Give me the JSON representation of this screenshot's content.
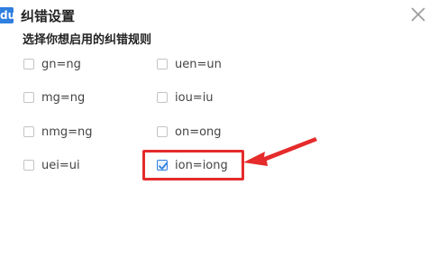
{
  "dialog": {
    "app_icon_text": "du",
    "title": "纠错设置",
    "close_glyph": "✕",
    "subtitle": "选择你想启用的纠错规则"
  },
  "options": [
    {
      "label": "gn=ng",
      "checked": false
    },
    {
      "label": "uen=un",
      "checked": false
    },
    {
      "label": "mg=ng",
      "checked": false
    },
    {
      "label": "iou=iu",
      "checked": false
    },
    {
      "label": "nmg=ng",
      "checked": false
    },
    {
      "label": "on=ong",
      "checked": false
    },
    {
      "label": "uei=ui",
      "checked": false
    },
    {
      "label": "ion=iong",
      "checked": true
    }
  ],
  "colors": {
    "accent": "#2f7fe0",
    "annotation": "#e52b2b"
  }
}
